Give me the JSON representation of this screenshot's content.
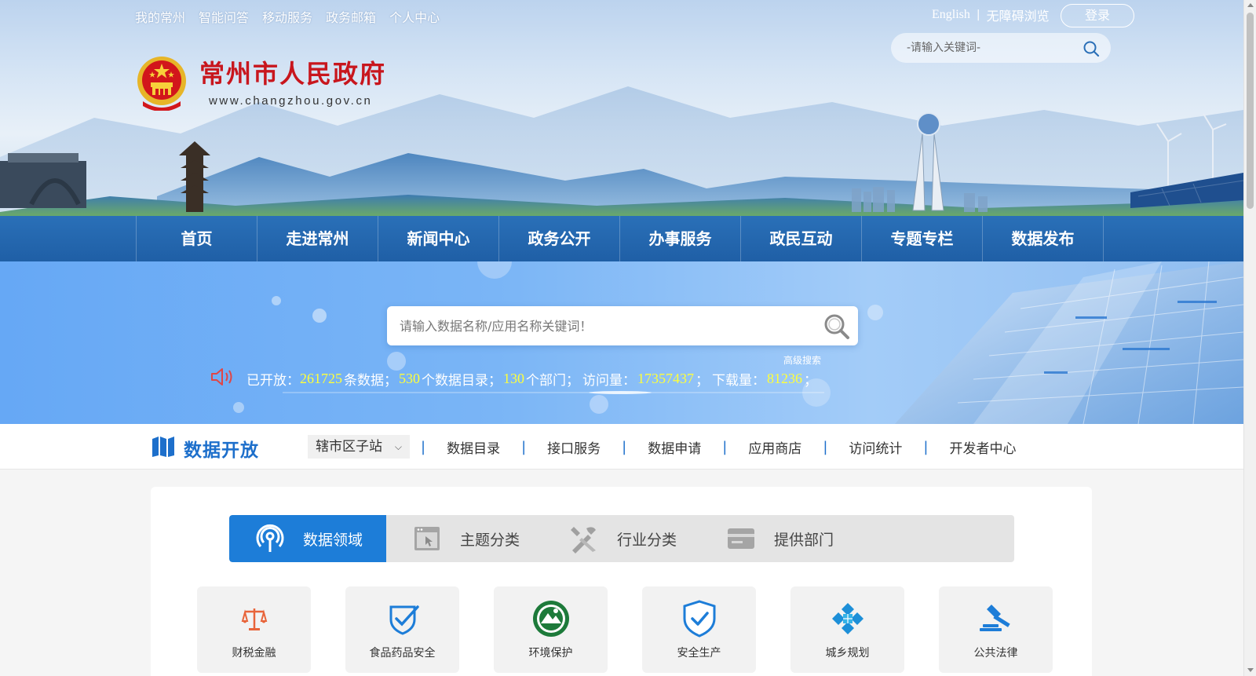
{
  "top_links": [
    "我的常州",
    "智能问答",
    "移动服务",
    "政务邮箱",
    "个人中心"
  ],
  "top_right": {
    "english": "English",
    "separator": "|",
    "accessible": "无障碍浏览",
    "login": "登录"
  },
  "top_search": {
    "placeholder": "-请输入关键词-"
  },
  "logo": {
    "title": "常州市人民政府",
    "url": "www.changzhou.gov.cn"
  },
  "main_nav": [
    "首页",
    "走进常州",
    "新闻中心",
    "政务公开",
    "办事服务",
    "政民互动",
    "专题专栏",
    "数据发布"
  ],
  "hero": {
    "search_placeholder": "请输入数据名称/应用名称关键词！",
    "advanced_search": "高级搜索",
    "stats": {
      "prefix": "已开放：",
      "datasets": "261725",
      "datasets_label": "条数据；",
      "catalogs": "530",
      "catalogs_label": "个数据目录；",
      "departments": "130",
      "departments_label": "个部门；",
      "visits_label": "访问量：",
      "visits": "17357437",
      "visits_sep": "；",
      "downloads_label": "下载量：",
      "downloads": "81236",
      "downloads_sep": "；"
    }
  },
  "subnav": {
    "title": "数据开放",
    "district_select": "辖市区子站",
    "items": [
      "数据目录",
      "接口服务",
      "数据申请",
      "应用商店",
      "访问统计",
      "开发者中心"
    ]
  },
  "tabs": [
    {
      "label": "数据领域",
      "icon": "signal-tower-icon",
      "active": true
    },
    {
      "label": "主题分类",
      "icon": "window-cursor-icon",
      "active": false
    },
    {
      "label": "行业分类",
      "icon": "tools-icon",
      "active": false
    },
    {
      "label": "提供部门",
      "icon": "card-icon",
      "active": false
    }
  ],
  "categories": [
    {
      "label": "财税金融",
      "icon": "scale-icon"
    },
    {
      "label": "食品药品安全",
      "icon": "shield-check-icon"
    },
    {
      "label": "环境保护",
      "icon": "environment-emblem-icon"
    },
    {
      "label": "安全生产",
      "icon": "safety-shield-icon"
    },
    {
      "label": "城乡规划",
      "icon": "planning-icon"
    },
    {
      "label": "公共法律",
      "icon": "gavel-icon"
    }
  ],
  "colors": {
    "nav_blue": "#1f5fa6",
    "accent_blue": "#1d7dd8",
    "gov_red": "#c8161d",
    "stat_yellow": "#ffff3a"
  }
}
